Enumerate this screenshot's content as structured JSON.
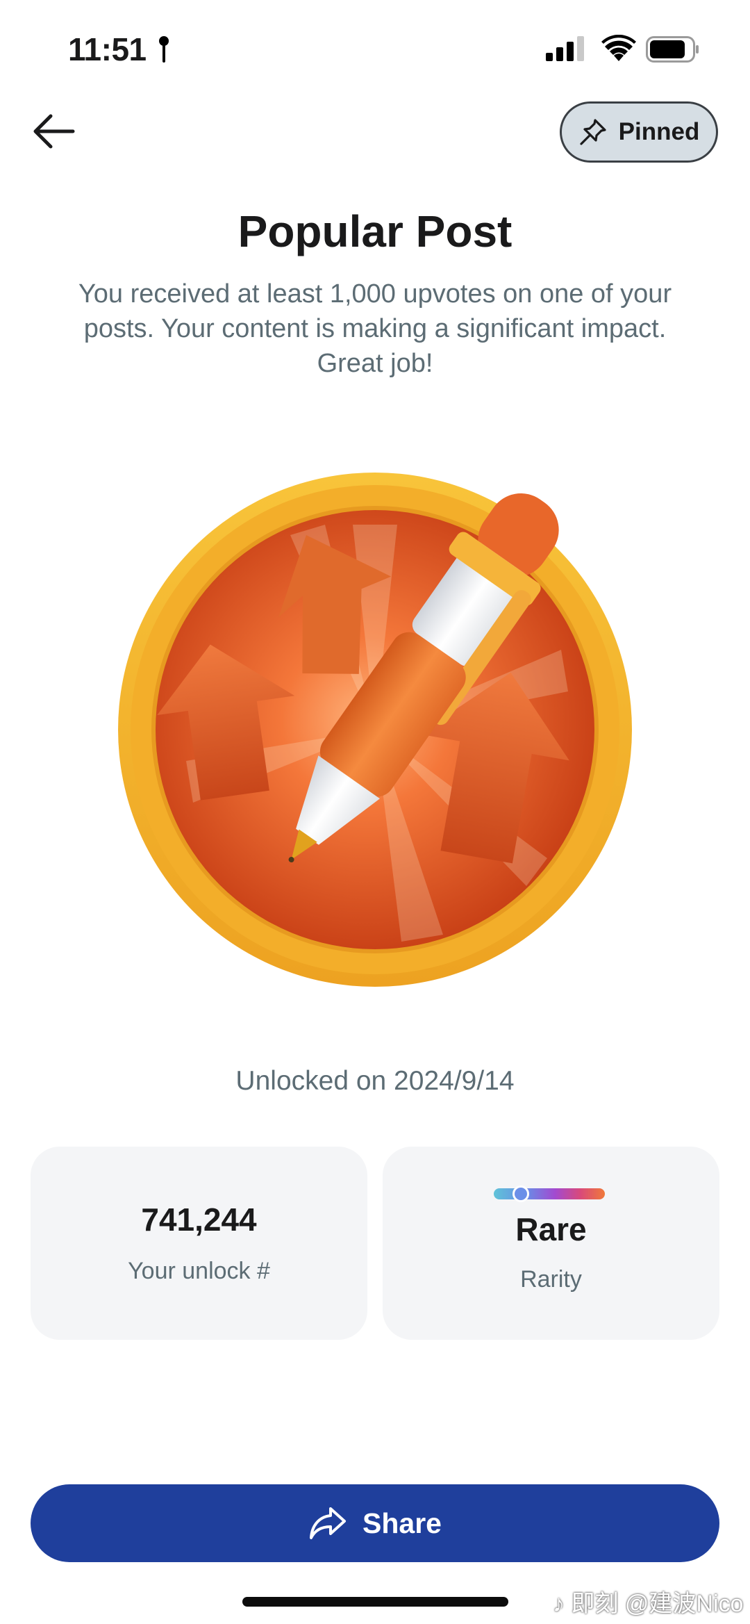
{
  "status_bar": {
    "time": "11:51",
    "icons": [
      "location-pin-icon",
      "signal-icon",
      "wifi-icon",
      "battery-icon"
    ]
  },
  "header": {
    "back_icon": "arrow-left-icon",
    "pinned_label": "Pinned",
    "pinned_icon": "pin-icon"
  },
  "achievement": {
    "title": "Popular Post",
    "description": "You received at least 1,000 upvotes on one of your posts. Your content is making a significant impact. Great job!",
    "badge_icon": "pen-upvote-badge-icon",
    "unlocked_text": "Unlocked on 2024/9/14"
  },
  "stats": {
    "unlock_number": "741,244",
    "unlock_label": "Your unlock #",
    "rarity_value": "Rare",
    "rarity_label": "Rarity",
    "rarity_level": 0.2
  },
  "share": {
    "label": "Share",
    "icon": "share-arrow-icon"
  },
  "watermark": "♪ 即刻 @建波Nico",
  "colors": {
    "share_button": "#1f3f9c",
    "badge_ring": "#f5b82e",
    "badge_inner": "#e0531e",
    "card_bg": "#f4f5f7",
    "secondary_text": "#5c6c74"
  }
}
